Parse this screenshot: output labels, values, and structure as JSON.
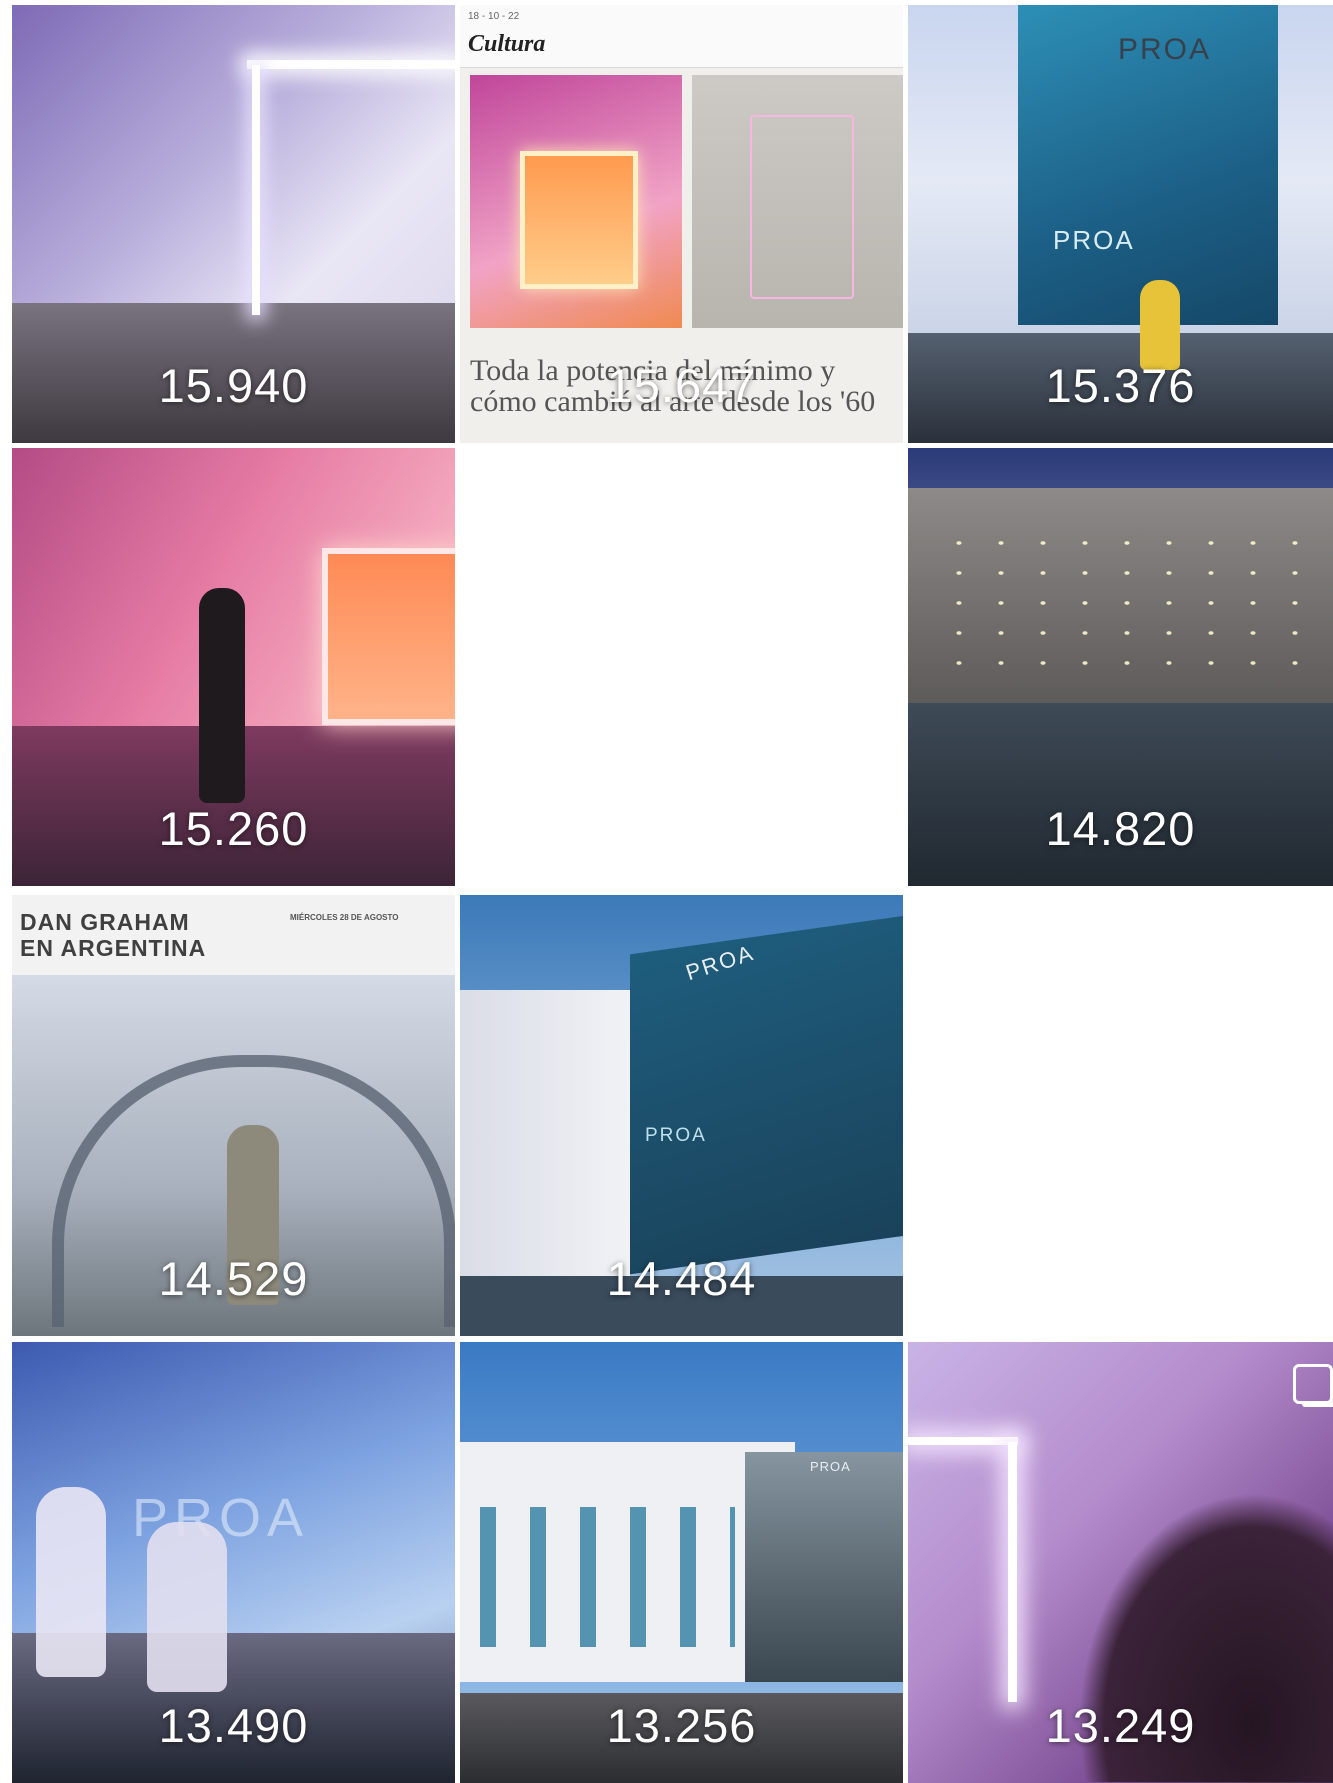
{
  "grid": {
    "tiles": [
      {
        "count": "15.940"
      },
      {
        "count": "15.647",
        "kicker": "18 - 10 - 22",
        "section": "Cultura",
        "headline": "Toda la potencia del mínimo y cómo cambió al arte desde los '60"
      },
      {
        "count": "15.376",
        "brand": "PROA",
        "brand_door": "PROA"
      },
      {
        "count": "15.260"
      },
      {
        "count": ""
      },
      {
        "count": "14.820"
      },
      {
        "count": "14.529",
        "title_line1": "DAN GRAHAM",
        "title_line2": "EN ARGENTINA",
        "date": "MIÉRCOLES 28 DE AGOSTO"
      },
      {
        "count": "14.484",
        "brand": "PROA",
        "brand_door": "PROA"
      },
      {
        "count": ""
      },
      {
        "count": "13.490",
        "brand": "PROA"
      },
      {
        "count": "13.256",
        "brand": "PROA"
      },
      {
        "count": "13.249"
      }
    ]
  }
}
